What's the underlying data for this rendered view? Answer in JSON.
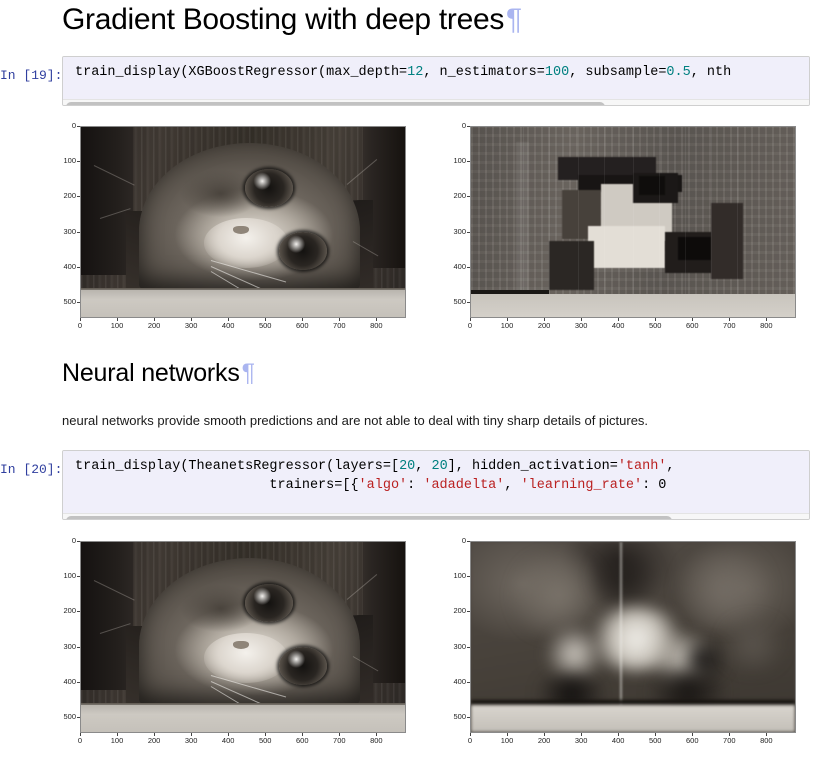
{
  "notebook": {
    "sections": [
      {
        "id": "gbm",
        "heading": "Gradient Boosting with deep trees",
        "anchor": "¶",
        "prompt": "In [19]:",
        "code_lines": [
          [
            {
              "t": "train_display(XGBoostRegressor(max_depth=",
              "c": "plain"
            },
            {
              "t": "12",
              "c": "num"
            },
            {
              "t": ", n_estimators=",
              "c": "plain"
            },
            {
              "t": "100",
              "c": "num"
            },
            {
              "t": ", subsample=",
              "c": "plain"
            },
            {
              "t": "0.5",
              "c": "num"
            },
            {
              "t": ", nth",
              "c": "plain"
            }
          ]
        ],
        "scrollbar": {
          "thumb_percent": 73
        },
        "figures": [
          {
            "name": "original-image",
            "caption": "original grayscale cat photograph"
          },
          {
            "name": "xgboost-reconstruction",
            "caption": "blocky XGBoost prediction of the image"
          }
        ]
      },
      {
        "id": "nn",
        "heading": "Neural networks",
        "anchor": "¶",
        "markdown": "neural networks provide smooth predictions and are not able to deal with tiny sharp details of pictures.",
        "prompt": "In [20]:",
        "code_lines": [
          [
            {
              "t": "train_display(TheanetsRegressor(layers=[",
              "c": "plain"
            },
            {
              "t": "20",
              "c": "num"
            },
            {
              "t": ", ",
              "c": "plain"
            },
            {
              "t": "20",
              "c": "num"
            },
            {
              "t": "], hidden_activation=",
              "c": "plain"
            },
            {
              "t": "'tanh'",
              "c": "str"
            },
            {
              "t": ",",
              "c": "plain"
            }
          ],
          [
            {
              "t": "                        trainers=[{",
              "c": "plain"
            },
            {
              "t": "'algo'",
              "c": "str"
            },
            {
              "t": ": ",
              "c": "plain"
            },
            {
              "t": "'adadelta'",
              "c": "str"
            },
            {
              "t": ", ",
              "c": "plain"
            },
            {
              "t": "'learning_rate'",
              "c": "str"
            },
            {
              "t": ": 0",
              "c": "plain"
            }
          ]
        ],
        "scrollbar": {
          "thumb_percent": 82
        },
        "figures": [
          {
            "name": "original-image",
            "caption": "original grayscale cat photograph"
          },
          {
            "name": "neuralnet-reconstruction",
            "caption": "smooth neural network prediction of the image"
          }
        ]
      }
    ]
  },
  "chart_data": [
    {
      "type": "heatmap",
      "title": "original image (XGBoost cell, left)",
      "xlabel": "",
      "ylabel": "",
      "xticks": [
        0,
        100,
        200,
        300,
        400,
        500,
        600,
        700,
        800
      ],
      "yticks": [
        0,
        100,
        200,
        300,
        400,
        500
      ],
      "xlim": [
        0,
        880
      ],
      "ylim": [
        545,
        0
      ],
      "colormap": "gray",
      "grid": false,
      "description": "Photograph of a tabby cat peeking through a hole in a dark wooden board, rendered in grayscale via imshow."
    },
    {
      "type": "heatmap",
      "title": "XGBoost reconstruction (XGBoost cell, right)",
      "xlabel": "",
      "ylabel": "",
      "xticks": [
        0,
        100,
        200,
        300,
        400,
        500,
        600,
        700,
        800
      ],
      "yticks": [
        0,
        100,
        200,
        300,
        400,
        500
      ],
      "xlim": [
        0,
        880
      ],
      "ylim": [
        545,
        0
      ],
      "colormap": "gray",
      "grid": false,
      "description": "Blocky, axis-aligned piecewise-constant reconstruction of the cat image produced by gradient boosted deep trees."
    },
    {
      "type": "heatmap",
      "title": "original image (neural network cell, left)",
      "xlabel": "",
      "ylabel": "",
      "xticks": [
        0,
        100,
        200,
        300,
        400,
        500,
        600,
        700,
        800
      ],
      "yticks": [
        0,
        100,
        200,
        300,
        400,
        500
      ],
      "xlim": [
        0,
        880
      ],
      "ylim": [
        545,
        0
      ],
      "colormap": "gray",
      "grid": false,
      "description": "Same grayscale cat photograph shown again for comparison."
    },
    {
      "type": "heatmap",
      "title": "Neural network reconstruction (neural network cell, right)",
      "xlabel": "",
      "ylabel": "",
      "xticks": [
        0,
        100,
        200,
        300,
        400,
        500,
        600,
        700,
        800
      ],
      "yticks": [
        0,
        100,
        200,
        300,
        400,
        500
      ],
      "xlim": [
        0,
        880
      ],
      "ylim": [
        545,
        0
      ],
      "colormap": "gray",
      "grid": false,
      "description": "Very smooth, blurry reconstruction of the cat image produced by a 20x20 tanh neural network; sharp details are lost."
    }
  ],
  "colors": {
    "code_background": "#f0effa",
    "prompt_text": "#303F9F",
    "string_token": "#BA2121",
    "number_token": "#008080",
    "anchor_link": "#aab5f0",
    "page_background": "#ffffff"
  }
}
